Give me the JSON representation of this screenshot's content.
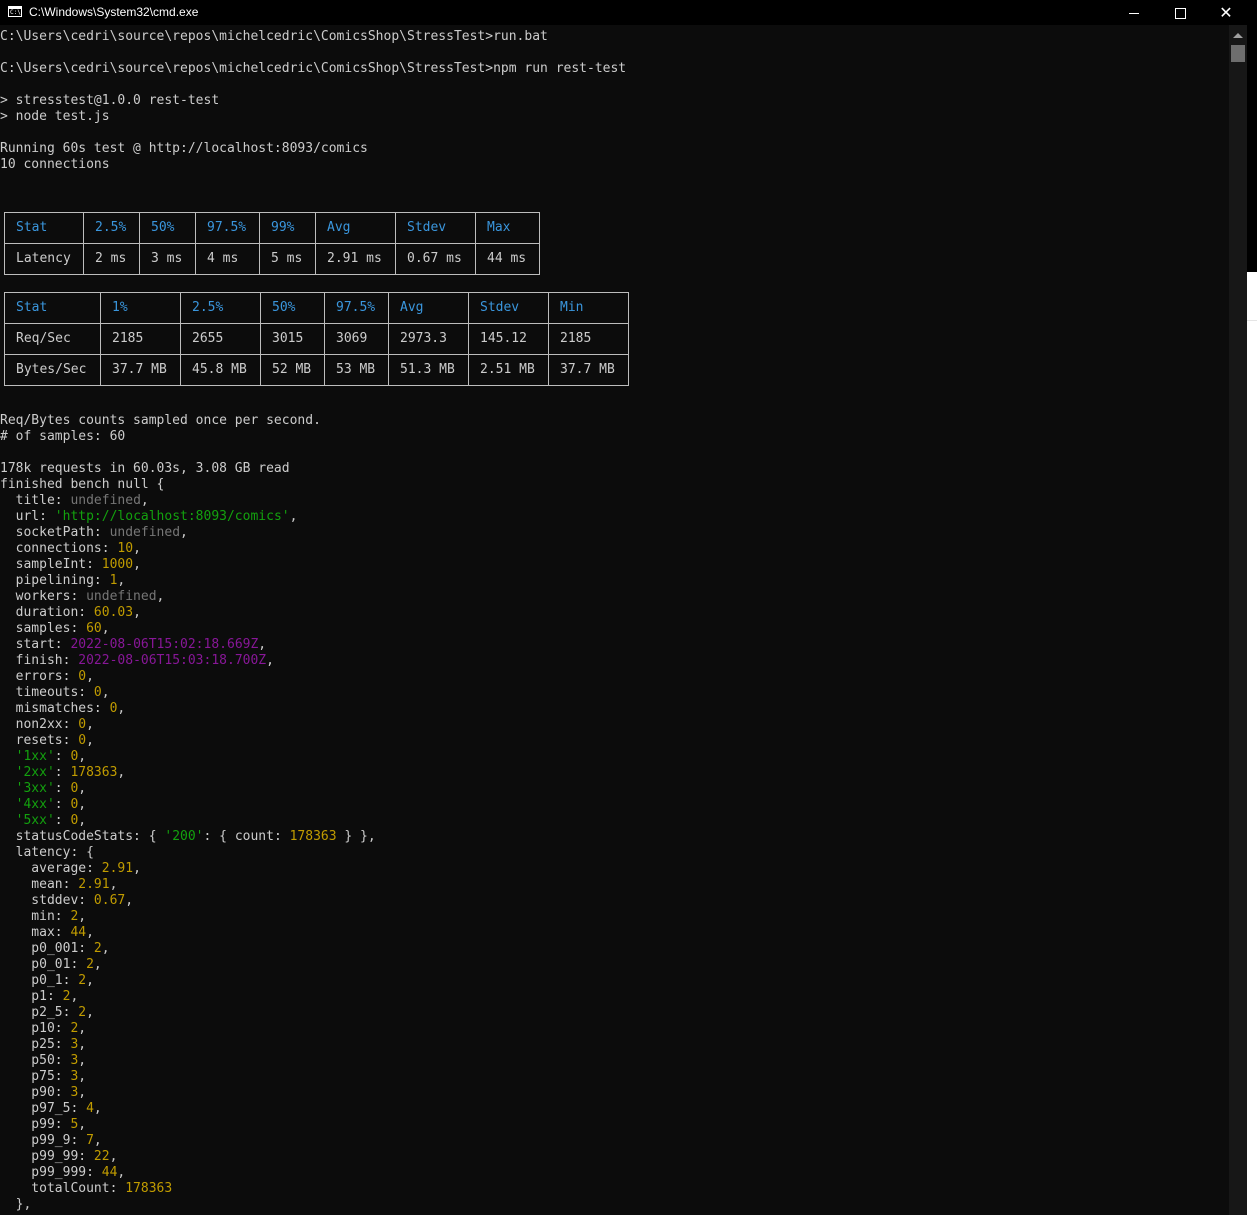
{
  "window": {
    "title": "C:\\Windows\\System32\\cmd.exe",
    "icon": "cmd-app-icon",
    "icon_text": "C:\\",
    "controls": {
      "minimize": "minimize-icon",
      "maximize": "maximize-icon",
      "close": "close-icon"
    }
  },
  "console": {
    "prompt1": "C:\\Users\\cedri\\source\\repos\\michelcedric\\ComicsShop\\StressTest>run.bat",
    "prompt2": "C:\\Users\\cedri\\source\\repos\\michelcedric\\ComicsShop\\StressTest>npm run rest-test",
    "npm_line1": "> stresstest@1.0.0 rest-test",
    "npm_line2": "> node test.js",
    "running": "Running 60s test @ http://localhost:8093/comics",
    "connections": "10 connections",
    "latency_table": {
      "headers": [
        "Stat",
        "2.5%",
        "50%",
        "97.5%",
        "99%",
        "Avg",
        "Stdev",
        "Max"
      ],
      "rows": [
        [
          "Latency",
          "2 ms",
          "3 ms",
          "4 ms",
          "5 ms",
          "2.91 ms",
          "0.67 ms",
          "44 ms"
        ]
      ]
    },
    "throughput_table": {
      "headers": [
        "Stat",
        "1%",
        "2.5%",
        "50%",
        "97.5%",
        "Avg",
        "Stdev",
        "Min"
      ],
      "rows": [
        [
          "Req/Sec",
          "2185",
          "2655",
          "3015",
          "3069",
          "2973.3",
          "145.12",
          "2185"
        ],
        [
          "Bytes/Sec",
          "37.7 MB",
          "45.8 MB",
          "52 MB",
          "53 MB",
          "51.3 MB",
          "2.51 MB",
          "37.7 MB"
        ]
      ]
    },
    "sampled_note": "Req/Bytes counts sampled once per second.",
    "samples_count": "# of samples: 60",
    "summary": "178k requests in 60.03s, 3.08 GB read",
    "finished": "finished bench null {",
    "object_lines": [
      [
        [
          "  title: ",
          "k"
        ],
        [
          "undefined",
          "u"
        ],
        [
          ",",
          "k"
        ]
      ],
      [
        [
          "  url: ",
          "k"
        ],
        [
          "'http://localhost:8093/comics'",
          "s"
        ],
        [
          ",",
          "k"
        ]
      ],
      [
        [
          "  socketPath: ",
          "k"
        ],
        [
          "undefined",
          "u"
        ],
        [
          ",",
          "k"
        ]
      ],
      [
        [
          "  connections: ",
          "k"
        ],
        [
          "10",
          "n"
        ],
        [
          ",",
          "k"
        ]
      ],
      [
        [
          "  sampleInt: ",
          "k"
        ],
        [
          "1000",
          "n"
        ],
        [
          ",",
          "k"
        ]
      ],
      [
        [
          "  pipelining: ",
          "k"
        ],
        [
          "1",
          "n"
        ],
        [
          ",",
          "k"
        ]
      ],
      [
        [
          "  workers: ",
          "k"
        ],
        [
          "undefined",
          "u"
        ],
        [
          ",",
          "k"
        ]
      ],
      [
        [
          "  duration: ",
          "k"
        ],
        [
          "60.03",
          "n"
        ],
        [
          ",",
          "k"
        ]
      ],
      [
        [
          "  samples: ",
          "k"
        ],
        [
          "60",
          "n"
        ],
        [
          ",",
          "k"
        ]
      ],
      [
        [
          "  start: ",
          "k"
        ],
        [
          "2022-08-06T15:02:18.669Z",
          "d"
        ],
        [
          ",",
          "k"
        ]
      ],
      [
        [
          "  finish: ",
          "k"
        ],
        [
          "2022-08-06T15:03:18.700Z",
          "d"
        ],
        [
          ",",
          "k"
        ]
      ],
      [
        [
          "  errors: ",
          "k"
        ],
        [
          "0",
          "n"
        ],
        [
          ",",
          "k"
        ]
      ],
      [
        [
          "  timeouts: ",
          "k"
        ],
        [
          "0",
          "n"
        ],
        [
          ",",
          "k"
        ]
      ],
      [
        [
          "  mismatches: ",
          "k"
        ],
        [
          "0",
          "n"
        ],
        [
          ",",
          "k"
        ]
      ],
      [
        [
          "  non2xx: ",
          "k"
        ],
        [
          "0",
          "n"
        ],
        [
          ",",
          "k"
        ]
      ],
      [
        [
          "  resets: ",
          "k"
        ],
        [
          "0",
          "n"
        ],
        [
          ",",
          "k"
        ]
      ],
      [
        [
          "  ",
          "k"
        ],
        [
          "'1xx'",
          "s"
        ],
        [
          ": ",
          "k"
        ],
        [
          "0",
          "n"
        ],
        [
          ",",
          "k"
        ]
      ],
      [
        [
          "  ",
          "k"
        ],
        [
          "'2xx'",
          "s"
        ],
        [
          ": ",
          "k"
        ],
        [
          "178363",
          "n"
        ],
        [
          ",",
          "k"
        ]
      ],
      [
        [
          "  ",
          "k"
        ],
        [
          "'3xx'",
          "s"
        ],
        [
          ": ",
          "k"
        ],
        [
          "0",
          "n"
        ],
        [
          ",",
          "k"
        ]
      ],
      [
        [
          "  ",
          "k"
        ],
        [
          "'4xx'",
          "s"
        ],
        [
          ": ",
          "k"
        ],
        [
          "0",
          "n"
        ],
        [
          ",",
          "k"
        ]
      ],
      [
        [
          "  ",
          "k"
        ],
        [
          "'5xx'",
          "s"
        ],
        [
          ": ",
          "k"
        ],
        [
          "0",
          "n"
        ],
        [
          ",",
          "k"
        ]
      ],
      [
        [
          "  statusCodeStats: { ",
          "k"
        ],
        [
          "'200'",
          "s"
        ],
        [
          ": { count: ",
          "k"
        ],
        [
          "178363",
          "n"
        ],
        [
          " } },",
          "k"
        ]
      ],
      [
        [
          "  latency: {",
          "k"
        ]
      ],
      [
        [
          "    average: ",
          "k"
        ],
        [
          "2.91",
          "n"
        ],
        [
          ",",
          "k"
        ]
      ],
      [
        [
          "    mean: ",
          "k"
        ],
        [
          "2.91",
          "n"
        ],
        [
          ",",
          "k"
        ]
      ],
      [
        [
          "    stddev: ",
          "k"
        ],
        [
          "0.67",
          "n"
        ],
        [
          ",",
          "k"
        ]
      ],
      [
        [
          "    min: ",
          "k"
        ],
        [
          "2",
          "n"
        ],
        [
          ",",
          "k"
        ]
      ],
      [
        [
          "    max: ",
          "k"
        ],
        [
          "44",
          "n"
        ],
        [
          ",",
          "k"
        ]
      ],
      [
        [
          "    p0_001: ",
          "k"
        ],
        [
          "2",
          "n"
        ],
        [
          ",",
          "k"
        ]
      ],
      [
        [
          "    p0_01: ",
          "k"
        ],
        [
          "2",
          "n"
        ],
        [
          ",",
          "k"
        ]
      ],
      [
        [
          "    p0_1: ",
          "k"
        ],
        [
          "2",
          "n"
        ],
        [
          ",",
          "k"
        ]
      ],
      [
        [
          "    p1: ",
          "k"
        ],
        [
          "2",
          "n"
        ],
        [
          ",",
          "k"
        ]
      ],
      [
        [
          "    p2_5: ",
          "k"
        ],
        [
          "2",
          "n"
        ],
        [
          ",",
          "k"
        ]
      ],
      [
        [
          "    p10: ",
          "k"
        ],
        [
          "2",
          "n"
        ],
        [
          ",",
          "k"
        ]
      ],
      [
        [
          "    p25: ",
          "k"
        ],
        [
          "3",
          "n"
        ],
        [
          ",",
          "k"
        ]
      ],
      [
        [
          "    p50: ",
          "k"
        ],
        [
          "3",
          "n"
        ],
        [
          ",",
          "k"
        ]
      ],
      [
        [
          "    p75: ",
          "k"
        ],
        [
          "3",
          "n"
        ],
        [
          ",",
          "k"
        ]
      ],
      [
        [
          "    p90: ",
          "k"
        ],
        [
          "3",
          "n"
        ],
        [
          ",",
          "k"
        ]
      ],
      [
        [
          "    p97_5: ",
          "k"
        ],
        [
          "4",
          "n"
        ],
        [
          ",",
          "k"
        ]
      ],
      [
        [
          "    p99: ",
          "k"
        ],
        [
          "5",
          "n"
        ],
        [
          ",",
          "k"
        ]
      ],
      [
        [
          "    p99_9: ",
          "k"
        ],
        [
          "7",
          "n"
        ],
        [
          ",",
          "k"
        ]
      ],
      [
        [
          "    p99_99: ",
          "k"
        ],
        [
          "22",
          "n"
        ],
        [
          ",",
          "k"
        ]
      ],
      [
        [
          "    p99_999: ",
          "k"
        ],
        [
          "44",
          "n"
        ],
        [
          ",",
          "k"
        ]
      ],
      [
        [
          "    totalCount: ",
          "k"
        ],
        [
          "178363",
          "n"
        ]
      ],
      [
        [
          "  },",
          "k"
        ]
      ]
    ]
  }
}
